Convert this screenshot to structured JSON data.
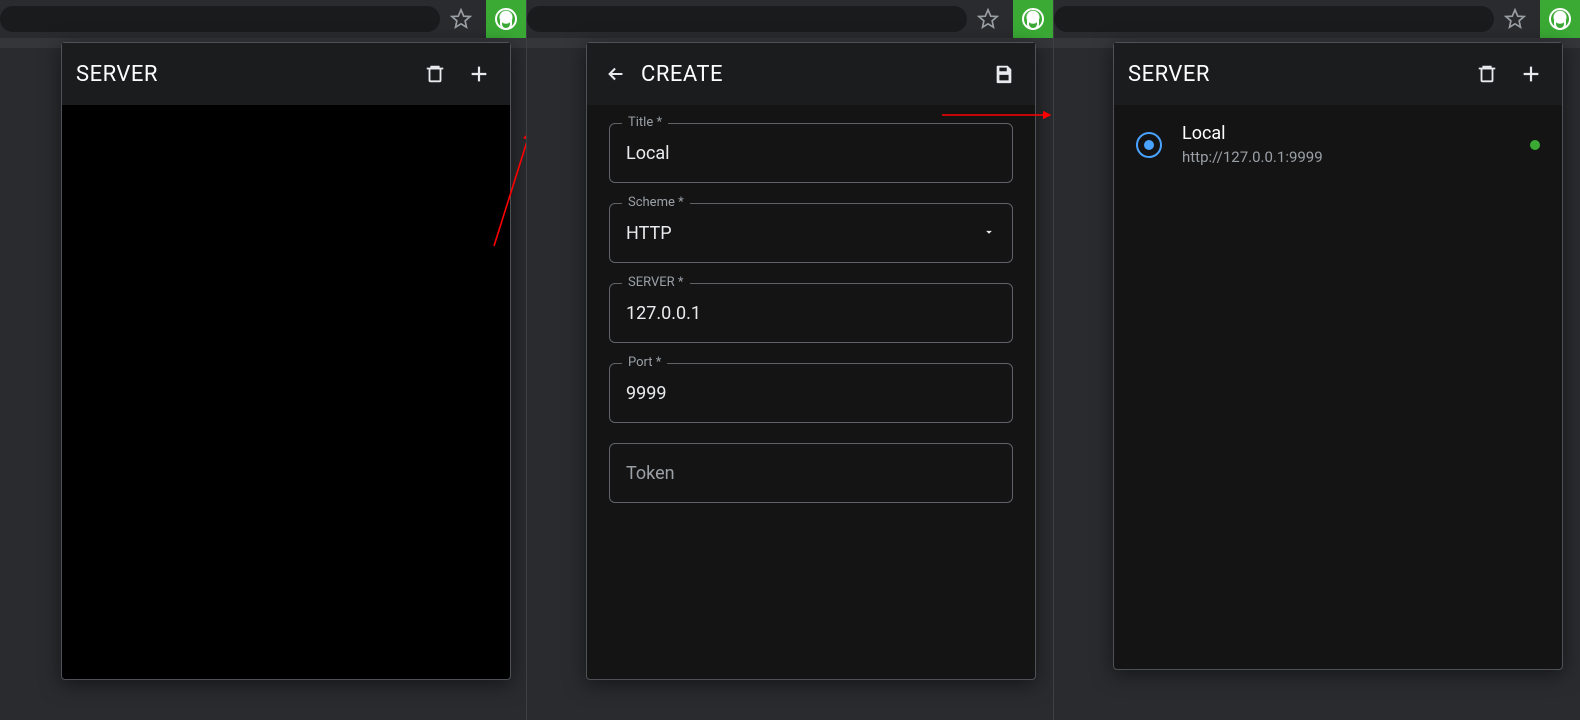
{
  "pane1": {
    "header_title": "SERVER"
  },
  "pane2": {
    "header_title": "CREATE",
    "fields": {
      "title_label": "Title *",
      "title_value": "Local",
      "scheme_label": "Scheme *",
      "scheme_value": "HTTP",
      "server_label": "SERVER *",
      "server_value": "127.0.0.1",
      "port_label": "Port *",
      "port_value": "9999",
      "token_placeholder": "Token"
    }
  },
  "pane3": {
    "header_title": "SERVER",
    "entry": {
      "title": "Local",
      "subtitle": "http://127.0.0.1:9999"
    }
  },
  "colors": {
    "accent_green": "#3aaa35",
    "accent_blue": "#4aa3ff",
    "arrow_red": "#ff0000"
  }
}
